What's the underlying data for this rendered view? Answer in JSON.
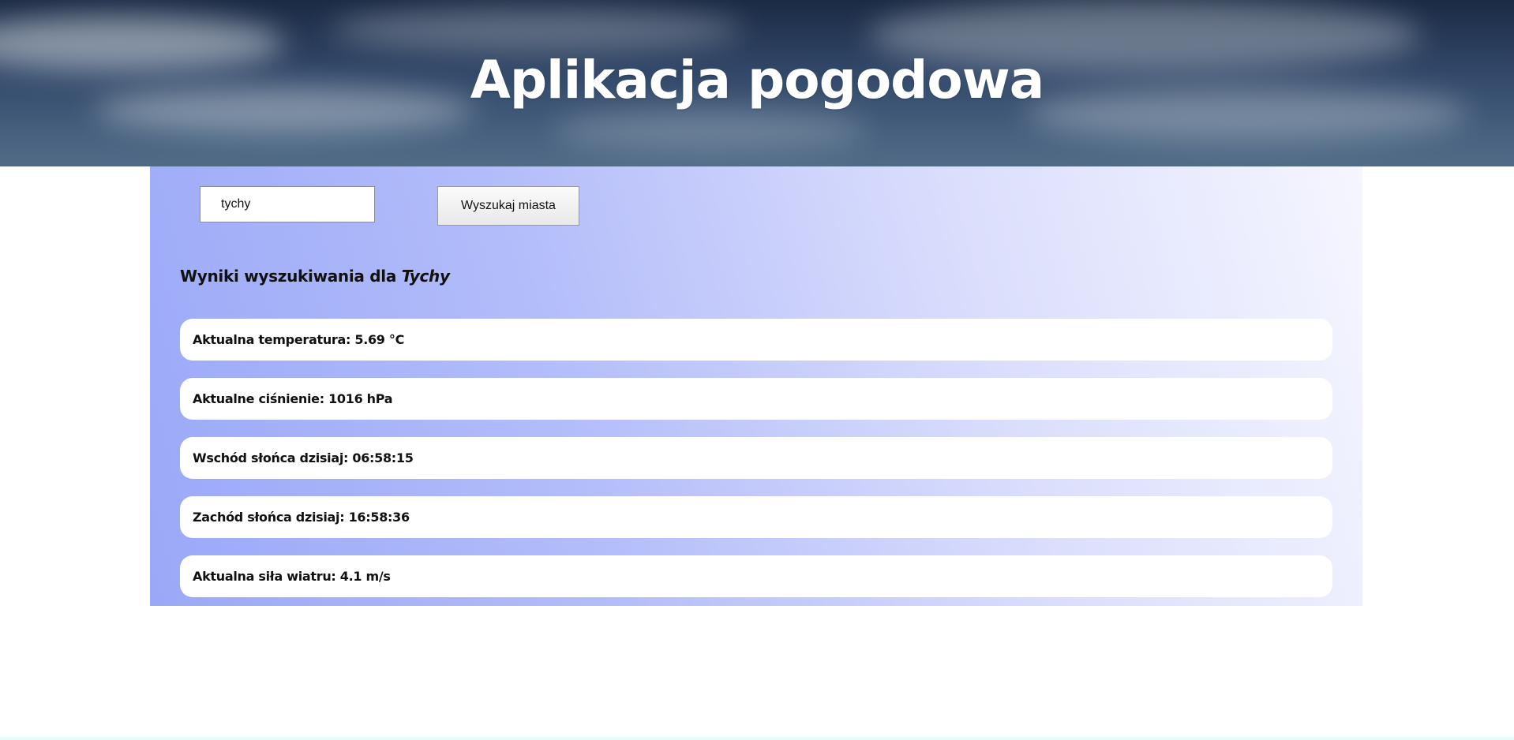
{
  "header": {
    "title": "Aplikacja pogodowa"
  },
  "search": {
    "value": "tychy",
    "button_label": "Wyszukaj miasta"
  },
  "results": {
    "heading_prefix": "Wyniki wyszukiwania dla",
    "city": "Tychy",
    "items": [
      {
        "label": "Aktualna temperatura: 5.69 °C"
      },
      {
        "label": "Aktualne ciśnienie: 1016 hPa"
      },
      {
        "label": "Wschód słońca dzisiaj: 06:58:15"
      },
      {
        "label": "Zachód słońca dzisiaj: 16:58:36"
      },
      {
        "label": "Aktualna siła wiatru: 4.1 m/s"
      }
    ]
  }
}
